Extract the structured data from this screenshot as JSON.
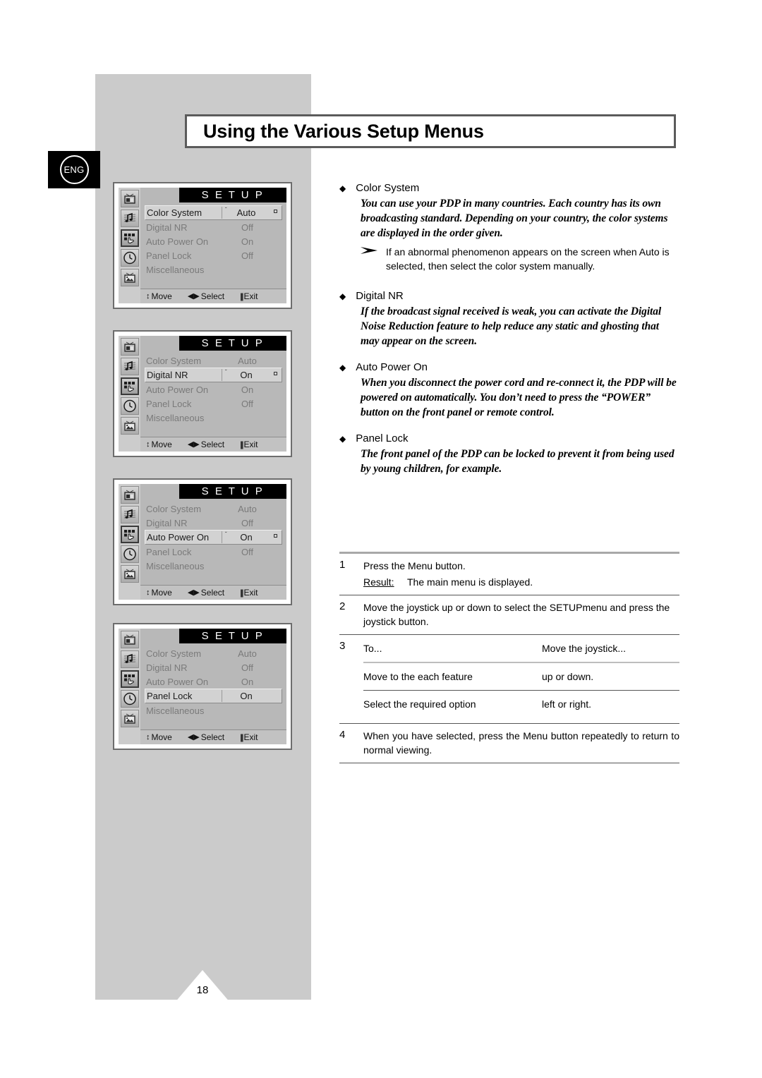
{
  "page": {
    "title": "Using the Various Setup Menus",
    "language_badge": "ENG",
    "page_number": "18"
  },
  "osd_menus": [
    {
      "title": "S E T U P",
      "selected_index": 0,
      "rail_icons": [
        "picture-tv-icon",
        "music-note-icon",
        "setup-hand-icon",
        "clock-icon",
        "screen-image-icon"
      ],
      "rail_active_index": 2,
      "rows": [
        {
          "label": "Color System",
          "value": "Auto"
        },
        {
          "label": "Digital NR",
          "value": "Off"
        },
        {
          "label": "Auto Power On",
          "value": "On"
        },
        {
          "label": "Panel Lock",
          "value": "Off"
        },
        {
          "label": "Miscellaneous",
          "value": ""
        }
      ],
      "footer": {
        "move": "Move",
        "select": "Select",
        "exit": "Exit"
      }
    },
    {
      "title": "S E T U P",
      "selected_index": 1,
      "rail_icons": [
        "picture-tv-icon",
        "music-note-icon",
        "setup-hand-icon",
        "clock-icon",
        "screen-image-icon"
      ],
      "rail_active_index": 2,
      "rows": [
        {
          "label": "Color System",
          "value": "Auto"
        },
        {
          "label": "Digital NR",
          "value": "On"
        },
        {
          "label": "Auto Power On",
          "value": "On"
        },
        {
          "label": "Panel Lock",
          "value": "Off"
        },
        {
          "label": "Miscellaneous",
          "value": ""
        }
      ],
      "footer": {
        "move": "Move",
        "select": "Select",
        "exit": "Exit"
      }
    },
    {
      "title": "S E T U P",
      "selected_index": 2,
      "rail_icons": [
        "picture-tv-icon",
        "music-note-icon",
        "setup-hand-icon",
        "clock-icon",
        "screen-image-icon"
      ],
      "rail_active_index": 2,
      "rows": [
        {
          "label": "Color System",
          "value": "Auto"
        },
        {
          "label": "Digital NR",
          "value": "Off"
        },
        {
          "label": "Auto Power On",
          "value": "On"
        },
        {
          "label": "Panel Lock",
          "value": "Off"
        },
        {
          "label": "Miscellaneous",
          "value": ""
        }
      ],
      "footer": {
        "move": "Move",
        "select": "Select",
        "exit": "Exit"
      }
    },
    {
      "title": "S E T U P",
      "selected_index": 3,
      "no_arrow_marks": true,
      "rail_icons": [
        "picture-tv-icon",
        "music-note-icon",
        "setup-hand-icon",
        "clock-icon",
        "screen-image-icon"
      ],
      "rail_active_index": 2,
      "rows": [
        {
          "label": "Color System",
          "value": "Auto"
        },
        {
          "label": "Digital NR",
          "value": "Off"
        },
        {
          "label": "Auto Power On",
          "value": "On"
        },
        {
          "label": "Panel Lock",
          "value": "On"
        },
        {
          "label": "Miscellaneous",
          "value": ""
        }
      ],
      "footer": {
        "move": "Move",
        "select": "Select",
        "exit": "Exit"
      }
    }
  ],
  "features": [
    {
      "name": "Color System",
      "description": "You can use your PDP in many countries. Each country has its own broadcasting standard. Depending on your country, the color systems are displayed in the order given.",
      "note": "If an abnormal phenomenon appears on the screen when Auto  is selected, then select the color system manually."
    },
    {
      "name": "Digital NR",
      "description": "If the broadcast signal received is weak, you can activate the Digital Noise Reduction feature to help reduce any static and ghosting that may appear on the screen."
    },
    {
      "name": "Auto Power On",
      "description": "When you disconnect the power cord and re-connect it, the PDP will be powered on automatically. You don’t need to press the “POWER” button on the front panel or remote control."
    },
    {
      "name": "Panel Lock",
      "description": "The front panel of the PDP can be locked to prevent it from being used by young children, for example."
    }
  ],
  "steps": {
    "step1": {
      "num": "1",
      "text": "Press the  Menu  button.",
      "result_label": "Result:",
      "result_text": "The main menu is displayed."
    },
    "step2": {
      "num": "2",
      "text": "Move the joystick up or down to select the  SETUPmenu and press the joystick button."
    },
    "step3": {
      "num": "3",
      "header_c1": "To...",
      "header_c2": "Move the joystick...",
      "rows": [
        {
          "c1": "Move to the each feature",
          "c2": "up or down."
        },
        {
          "c1": "Select the required option",
          "c2": "left or right."
        }
      ]
    },
    "step4": {
      "num": "4",
      "text": "When you have selected, press the  Menu  button repeatedly to return to normal viewing."
    }
  }
}
